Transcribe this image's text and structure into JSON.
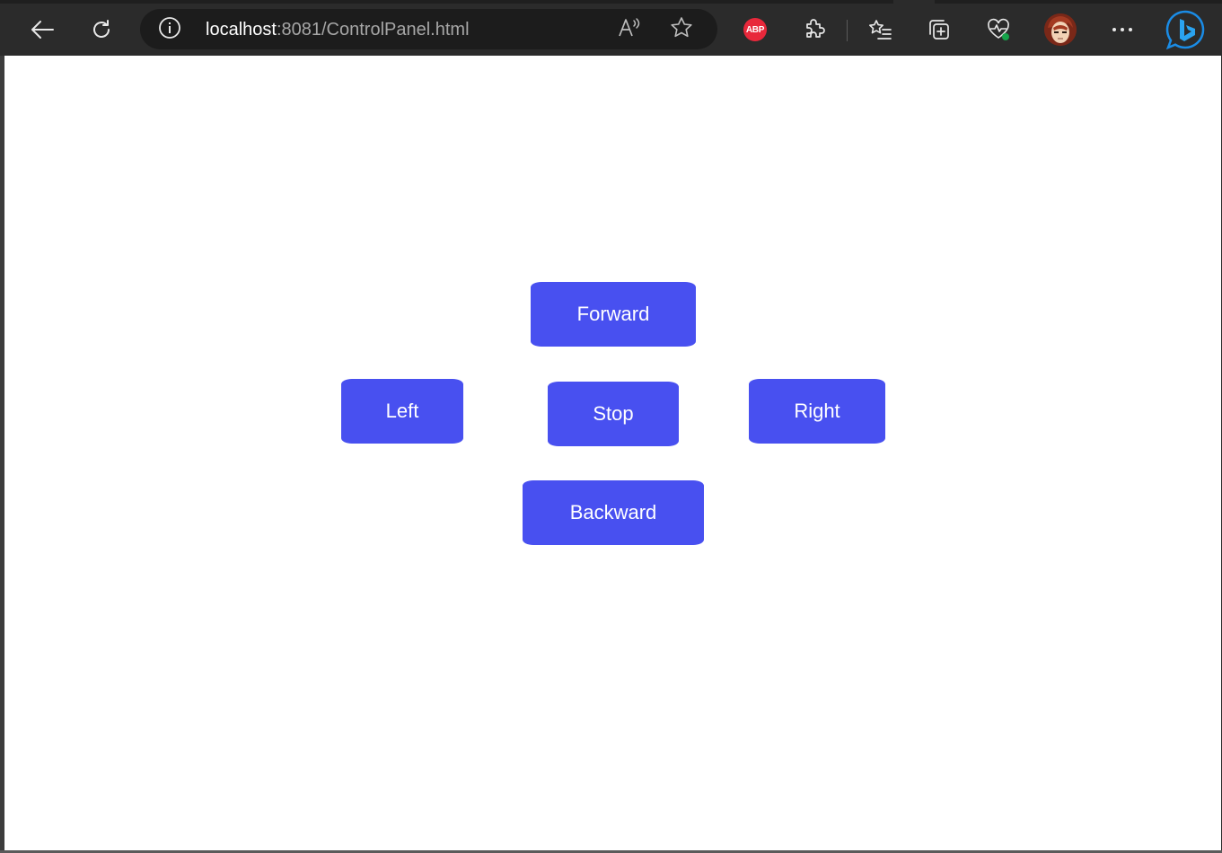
{
  "browser": {
    "url_host": "localhost",
    "url_rest": ":8081/ControlPanel.html",
    "abp_label": "ABP",
    "colors": {
      "toolbar": "#2b2b2b",
      "address_bar": "#1c1c1c",
      "abp": "#e8283b",
      "bing": "#1a8ce6"
    },
    "icons": {
      "back": "back-arrow-icon",
      "refresh": "refresh-icon",
      "site_info": "info-icon",
      "read_aloud": "read-aloud-icon",
      "favorite": "star-icon",
      "adblock": "adblock-plus-icon",
      "extensions": "extensions-puzzle-icon",
      "favorites": "favorites-list-icon",
      "collections": "collections-icon",
      "browser_essentials": "heartbeat-icon",
      "profile": "profile-avatar",
      "more": "more-dots-icon",
      "copilot": "bing-copilot-icon"
    }
  },
  "panel": {
    "button_color": "#4850f0",
    "buttons": {
      "forward": "Forward",
      "left": "Left",
      "stop": "Stop",
      "right": "Right",
      "backward": "Backward"
    }
  }
}
